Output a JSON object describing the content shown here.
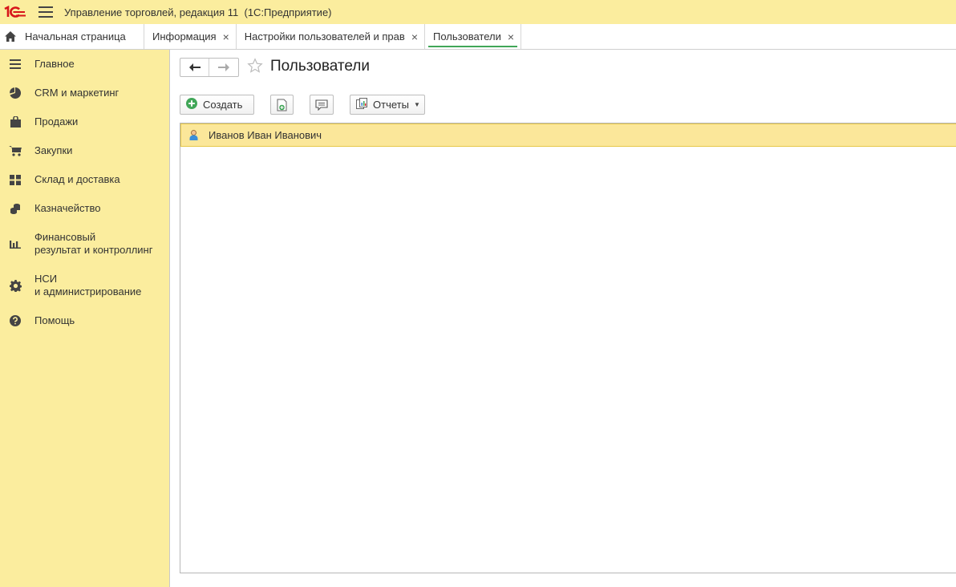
{
  "app": {
    "title": "Управление торговлей, редакция 11  (1С:Предприятие)",
    "logo_text": "1С"
  },
  "tabs": [
    {
      "label": "Начальная страница",
      "closable": false
    },
    {
      "label": "Информация",
      "closable": true
    },
    {
      "label": "Настройки пользователей и прав",
      "closable": true
    },
    {
      "label": "Пользователи",
      "closable": true,
      "active": true
    }
  ],
  "tab_close_glyph": "×",
  "sidebar": {
    "items": [
      {
        "label": "Главное",
        "icon": "menu-lines-icon"
      },
      {
        "label": "CRM и маркетинг",
        "icon": "pie-chart-icon"
      },
      {
        "label": "Продажи",
        "icon": "shopping-bag-icon"
      },
      {
        "label": "Закупки",
        "icon": "cart-icon"
      },
      {
        "label": "Склад и доставка",
        "icon": "warehouse-grid-icon"
      },
      {
        "label": "Казначейство",
        "icon": "coins-icon"
      },
      {
        "label": "Финансовый\nрезультат и контроллинг",
        "label_line1": "Финансовый",
        "label_line2": "результат и контроллинг",
        "icon": "bar-chart-icon"
      },
      {
        "label": "НСИ\nи администрирование",
        "label_line1": "НСИ",
        "label_line2": "и администрирование",
        "icon": "gear-icon"
      },
      {
        "label": "Помощь",
        "icon": "help-icon"
      }
    ]
  },
  "content": {
    "title": "Пользователи",
    "toolbar": {
      "create_label": "Создать",
      "reports_label": "Отчеты"
    },
    "list": {
      "rows": [
        {
          "name": "Иванов Иван Иванович",
          "icon": "user-icon",
          "selected": true
        }
      ]
    }
  },
  "colors": {
    "accent_yellow": "#fbed9e",
    "selected_row": "#fbe79a",
    "active_tab_underline": "#41a658",
    "logo_red": "#d7141a",
    "create_green": "#41a658"
  }
}
